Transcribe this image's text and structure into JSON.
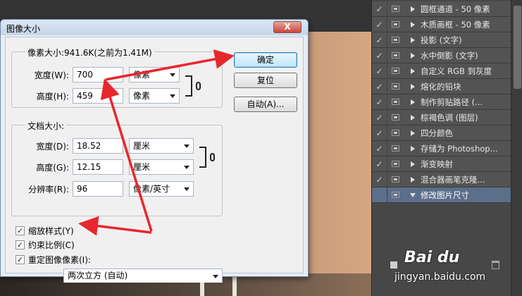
{
  "dialog": {
    "title": "图像大小",
    "close_label": "X",
    "pixel_group": {
      "legend": "像素大小:941.6K(之前为1.41M)",
      "width_label": "宽度(W):",
      "width_value": "700",
      "width_unit": "像素",
      "height_label": "高度(H):",
      "height_value": "459",
      "height_unit": "像素"
    },
    "doc_group": {
      "legend": "文档大小:",
      "width_label": "宽度(D):",
      "width_value": "18.52",
      "width_unit": "厘米",
      "height_label": "高度(G):",
      "height_value": "12.15",
      "height_unit": "厘米",
      "resolution_label": "分辨率(R):",
      "resolution_value": "96",
      "resolution_unit": "像素/英寸"
    },
    "buttons": {
      "ok": "确定",
      "reset": "复位",
      "auto": "自动(A)..."
    },
    "checkboxes": {
      "scale_styles": {
        "label": "缩放样式(Y)",
        "checked": true
      },
      "constrain": {
        "label": "约束比例(C)",
        "checked": true
      },
      "resample": {
        "label": "重定图像像素(I):",
        "checked": true
      }
    },
    "resample_method": "两次立方 (自动)",
    "check_mark": "✓"
  },
  "layers": {
    "items": [
      {
        "name": "圆框通道 - 50 像素",
        "visible": true,
        "expanded": false
      },
      {
        "name": "木质画框 - 50 像素",
        "visible": true,
        "expanded": false
      },
      {
        "name": "投影 (文字)",
        "visible": true,
        "expanded": false
      },
      {
        "name": "水中倒影 (文字)",
        "visible": true,
        "expanded": false
      },
      {
        "name": "自定义 RGB 到灰度",
        "visible": true,
        "expanded": false
      },
      {
        "name": "熔化的铅块",
        "visible": true,
        "expanded": false
      },
      {
        "name": "制作剪贴路径 (...",
        "visible": true,
        "expanded": false
      },
      {
        "name": "棕褐色调 (图层)",
        "visible": true,
        "expanded": false
      },
      {
        "name": "四分颜色",
        "visible": true,
        "expanded": false
      },
      {
        "name": "存储为 Photoshop...",
        "visible": true,
        "expanded": false
      },
      {
        "name": "渐变映射",
        "visible": true,
        "expanded": false
      },
      {
        "name": "混合器画笔克隆...",
        "visible": true,
        "expanded": false
      },
      {
        "name": "修改图片尺寸",
        "visible": false,
        "expanded": true,
        "selected": true
      }
    ],
    "check_glyph": "✓"
  },
  "watermark": {
    "brand": "Bai du",
    "url": "jingyan.baidu.com"
  },
  "colors": {
    "annotation_red": "#e8272c",
    "selected_layer": "#5b6e8a",
    "panel_bg": "#474747"
  }
}
